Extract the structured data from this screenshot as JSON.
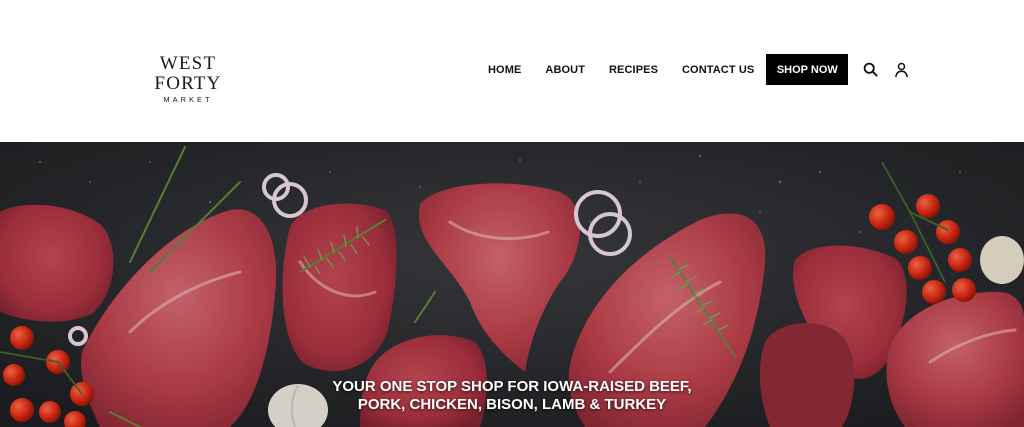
{
  "brand": {
    "name": "WEST FORTY",
    "tagline": "MARKET"
  },
  "nav": {
    "items": [
      {
        "label": "HOME"
      },
      {
        "label": "ABOUT"
      },
      {
        "label": "RECIPES"
      },
      {
        "label": "CONTACT US"
      }
    ],
    "cta_label": "SHOP NOW"
  },
  "icons": {
    "search": "search-icon",
    "account": "user-icon"
  },
  "hero": {
    "headline_line1": "YOUR ONE STOP SHOP FOR IOWA-RAISED BEEF,",
    "headline_line2": "PORK, CHICKEN, BISON, LAMB & TURKEY"
  },
  "colors": {
    "cta_background": "#000000",
    "cta_text": "#ffffff",
    "hero_background": "#2a2b2e",
    "meat": "#b8424b"
  }
}
